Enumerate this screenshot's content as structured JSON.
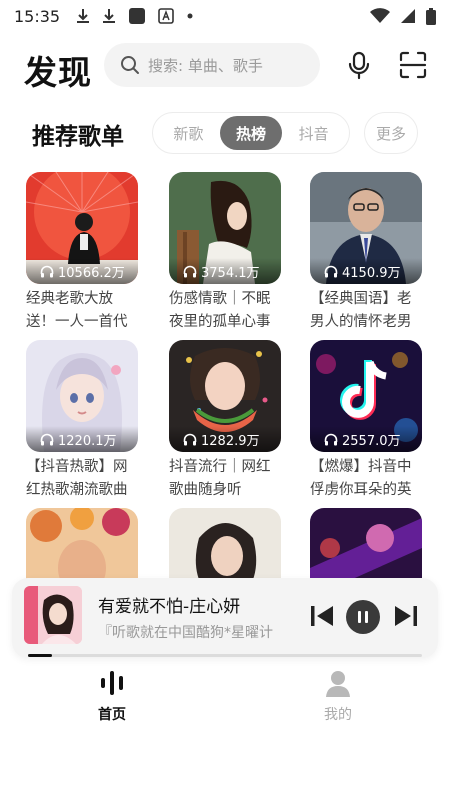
{
  "status_bar": {
    "time": "15:35",
    "icons": [
      "download-icon",
      "download-icon",
      "app-square-icon",
      "keyboard-a-icon",
      "dot-icon",
      "wifi-icon",
      "signal-icon",
      "battery-icon"
    ]
  },
  "header": {
    "title": "发现",
    "search_placeholder": "搜索: 单曲、歌手"
  },
  "section": {
    "title": "推荐歌单",
    "tabs": [
      {
        "label": "新歌",
        "active": false
      },
      {
        "label": "热榜",
        "active": true
      },
      {
        "label": "抖音",
        "active": false
      }
    ],
    "more_label": "更多"
  },
  "playlists": [
    {
      "count": "10566.2万",
      "title": "经典老歌大放送！一人一首代"
    },
    {
      "count": "3754.1万",
      "title": "伤感情歌｜不眠夜里的孤单心事"
    },
    {
      "count": "4150.9万",
      "title": "【经典国语】老男人的情怀老男"
    },
    {
      "count": "1220.1万",
      "title": "【抖音热歌】网红热歌潮流歌曲"
    },
    {
      "count": "1282.9万",
      "title": "抖音流行｜网红歌曲随身听"
    },
    {
      "count": "2557.0万",
      "title": "【燃爆】抖音中俘虏你耳朵的英"
    },
    {
      "count": "",
      "title": ""
    },
    {
      "count": "",
      "title": ""
    },
    {
      "count": "",
      "title": ""
    }
  ],
  "player": {
    "title": "有爱就不怕-庄心妍",
    "subtitle": "『听歌就在中国酷狗*星曜计",
    "progress": 0.06
  },
  "nav": {
    "home_label": "首页",
    "mine_label": "我的"
  },
  "colors": {
    "tab_active_bg": "#6e6e6e",
    "text_primary": "#111111",
    "text_muted": "#aaaaaa"
  }
}
